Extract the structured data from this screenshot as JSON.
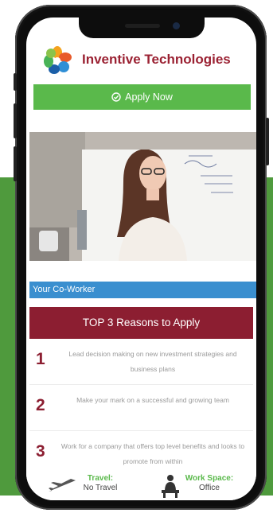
{
  "company": {
    "name": "Inventive Technologies"
  },
  "apply": {
    "label": "Apply Now"
  },
  "coworker": {
    "label": "Your Co-Worker"
  },
  "reasons": {
    "title": "TOP 3 Reasons to Apply",
    "items": [
      {
        "num": "1",
        "text": "Lead decision making on new investment strategies and business plans"
      },
      {
        "num": "2",
        "text": "Make your mark on a successful and growing team"
      },
      {
        "num": "3",
        "text": "Work for a company that offers top level benefits and looks to promote from within"
      }
    ]
  },
  "footer": {
    "travel": {
      "label": "Travel:",
      "value": "No Travel",
      "icon": "airplane-icon"
    },
    "workspace": {
      "label": "Work Space:",
      "value": "Office",
      "icon": "desk-person-icon"
    }
  },
  "colors": {
    "brand": "#9b2233",
    "apply_green": "#5ab94b",
    "coworker_blue": "#3a8fcf",
    "background_green": "#4f9a3d"
  }
}
